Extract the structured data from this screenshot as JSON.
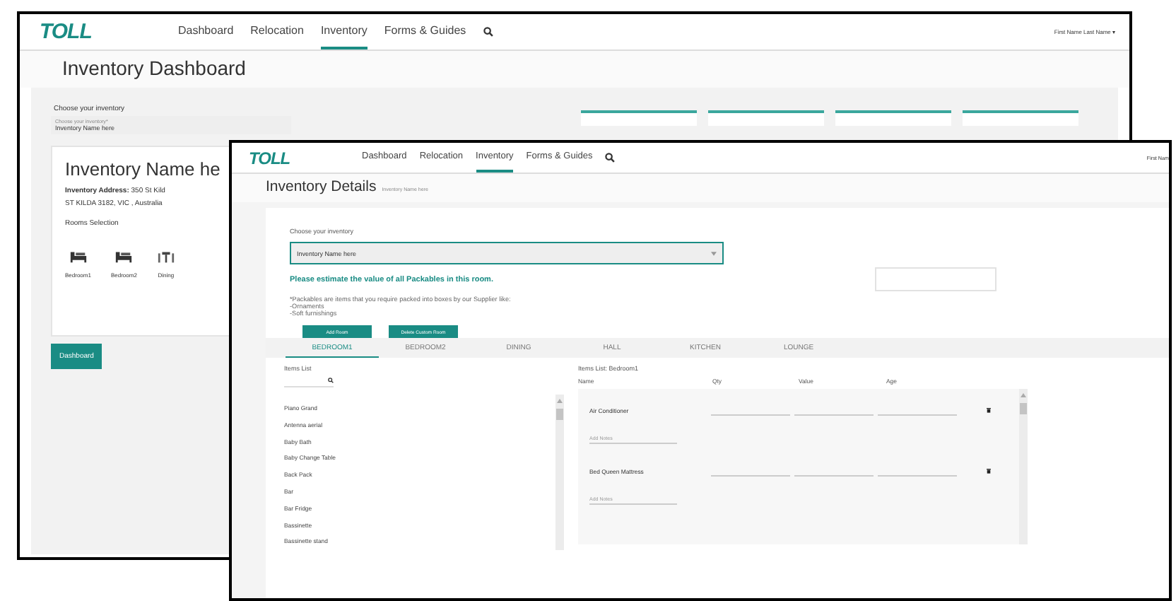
{
  "back_window": {
    "nav": {
      "logo": "TOLL",
      "links": [
        {
          "label": "Dashboard",
          "selected": false
        },
        {
          "label": "Relocation",
          "selected": false
        },
        {
          "label": "Inventory",
          "selected": true
        },
        {
          "label": "Forms & Guides",
          "selected": false
        }
      ],
      "user": "First Name Last Name ▾"
    },
    "title": "Inventory Dashboard",
    "chooser": {
      "label": "Choose your inventory",
      "select_label": "Choose your inventory*",
      "value": "Inventory Name here"
    },
    "inventory_card": {
      "name": "Inventory Name he",
      "address_1": "**Inventory Address:** 350 St Kild",
      "address_2": "ST KILDA 3182, VIC , Australia",
      "rooms_label": "Rooms Selection",
      "rooms": [
        {
          "kind": "bed",
          "label": "Bedroom1"
        },
        {
          "kind": "bed",
          "label": "Bedroom2"
        },
        {
          "kind": "dining",
          "label": "Dining"
        }
      ]
    },
    "button": "Dashboard"
  },
  "front_window": {
    "nav": {
      "logo": "TOLL",
      "links": [
        {
          "label": "Dashboard",
          "selected": false
        },
        {
          "label": "Relocation",
          "selected": false
        },
        {
          "label": "Inventory",
          "selected": true
        },
        {
          "label": "Forms & Guides",
          "selected": false
        }
      ],
      "user": "First Nam"
    },
    "title": "Inventory Details",
    "subtitle": "Inventory Name here",
    "chooser": {
      "label": "Choose your inventory",
      "value": "Inventory Name here"
    },
    "prompt": "Please estimate the value of all Packables in this room.",
    "notes": [
      "*Packables are items that you require packed into boxes by our Supplier like:",
      "-Ornaments",
      "-Soft furnishings"
    ],
    "buttons": [
      "Add Room",
      "Delete Custom Room"
    ],
    "tabs": [
      {
        "label": "BEDROOM1",
        "selected": true
      },
      {
        "label": "BEDROOM2",
        "selected": false
      },
      {
        "label": "DINING",
        "selected": false
      },
      {
        "label": "HALL",
        "selected": false
      },
      {
        "label": "KITCHEN",
        "selected": false
      },
      {
        "label": "LOUNGE",
        "selected": false
      }
    ],
    "items_list": {
      "title": "Items List",
      "items": [
        "Piano Grand",
        "Antenna aerial",
        "Baby Bath",
        "Baby Change Table",
        "Back Pack",
        "Bar",
        "Bar Fridge",
        "Bassinette",
        "Bassinette stand"
      ]
    },
    "room_list": {
      "title": "Items List: Bedroom1",
      "columns": [
        "Name",
        "Qty",
        "Value",
        "Age"
      ],
      "rows": [
        {
          "name": "Air Conditioner",
          "notes_placeholder": "Add Notes"
        },
        {
          "name": "Bed Queen Mattress",
          "notes_placeholder": "Add Notes"
        }
      ]
    }
  }
}
